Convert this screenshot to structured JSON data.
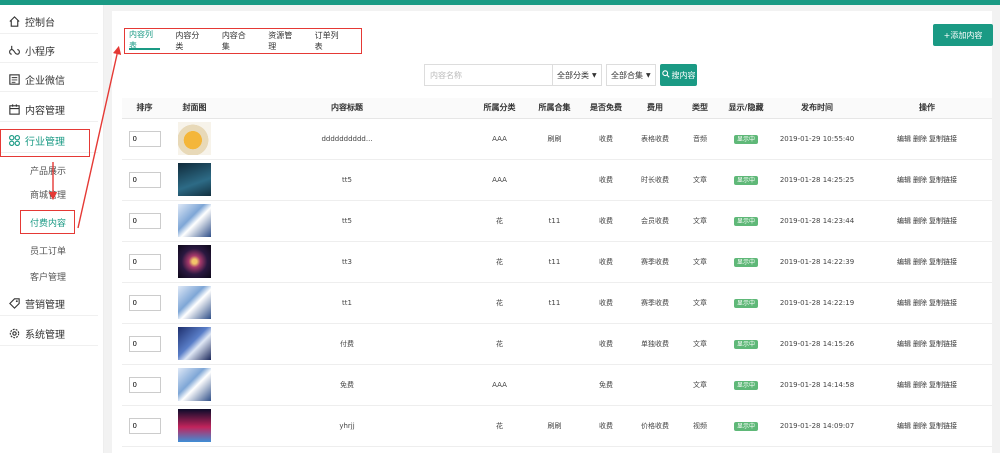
{
  "sidebar": {
    "items": [
      {
        "label": "控制台",
        "icon": "home-icon"
      },
      {
        "label": "小程序",
        "icon": "miniapp-icon"
      },
      {
        "label": "企业微信",
        "icon": "enterprise-wechat-icon"
      },
      {
        "label": "内容管理",
        "icon": "calendar-icon"
      },
      {
        "label": "行业管理",
        "icon": "industry-icon"
      },
      {
        "label": "营销管理",
        "icon": "tag-icon"
      },
      {
        "label": "系统管理",
        "icon": "gear-icon"
      }
    ],
    "subitems": [
      "产品展示",
      "商城管理",
      "付费内容",
      "员工订单",
      "客户管理"
    ]
  },
  "tabs": [
    "内容列表",
    "内容分类",
    "内容合集",
    "资源管理",
    "订单列表"
  ],
  "add_button": "+添加内容",
  "search": {
    "placeholder": "内容名称",
    "category": "全部分类",
    "collection": "全部合集",
    "button": "搜内容"
  },
  "table": {
    "headers": [
      "排序",
      "封面图",
      "内容标题",
      "所属分类",
      "所属合集",
      "是否免费",
      "费用",
      "类型",
      "显示/隐藏",
      "发布时间",
      "操作"
    ],
    "ops": [
      "编辑",
      "删除",
      "复制链接"
    ],
    "rows": [
      {
        "sort": "0",
        "cover": "jar",
        "title": "dddddddddd...",
        "category": "AAA",
        "collection": "刷刷",
        "free": "收费",
        "fee": "表格收费",
        "type": "音频",
        "status": "显示中",
        "time": "2019-01-29 10:55:40"
      },
      {
        "sort": "0",
        "cover": "ocean",
        "title": "tt5",
        "category": "AAA",
        "collection": "",
        "free": "收费",
        "fee": "时长收费",
        "type": "文章",
        "status": "显示中",
        "time": "2019-01-28 14:25:25"
      },
      {
        "sort": "0",
        "cover": "anime",
        "title": "tt5",
        "category": "花",
        "collection": "t11",
        "free": "收费",
        "fee": "会员收费",
        "type": "文章",
        "status": "显示中",
        "time": "2019-01-28 14:23:44"
      },
      {
        "sort": "0",
        "cover": "fireworks",
        "title": "tt3",
        "category": "花",
        "collection": "t11",
        "free": "收费",
        "fee": "赛季收费",
        "type": "文章",
        "status": "显示中",
        "time": "2019-01-28 14:22:39"
      },
      {
        "sort": "0",
        "cover": "anime",
        "title": "tt1",
        "category": "花",
        "collection": "t11",
        "free": "收费",
        "fee": "赛季收费",
        "type": "文章",
        "status": "显示中",
        "time": "2019-01-28 14:22:19"
      },
      {
        "sort": "0",
        "cover": "anime-dark",
        "title": "付费",
        "category": "花",
        "collection": "",
        "free": "收费",
        "fee": "单独收费",
        "type": "文章",
        "status": "显示中",
        "time": "2019-01-28 14:15:26"
      },
      {
        "sort": "0",
        "cover": "anime",
        "title": "免费",
        "category": "AAA",
        "collection": "",
        "free": "免费",
        "fee": "",
        "type": "文章",
        "status": "显示中",
        "time": "2019-01-28 14:14:58"
      },
      {
        "sort": "0",
        "cover": "triangle",
        "title": "yhrjj",
        "category": "花",
        "collection": "刷刷",
        "free": "收费",
        "fee": "价格收费",
        "type": "视频",
        "status": "显示中",
        "time": "2019-01-28 14:09:07"
      }
    ]
  },
  "colors": {
    "accent": "#1a9a84",
    "badge": "#5fb878",
    "highlight": "#e53935"
  }
}
